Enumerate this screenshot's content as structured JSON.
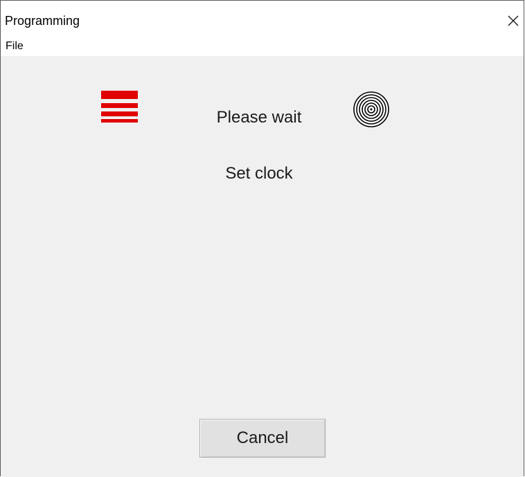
{
  "window": {
    "title": "Programming"
  },
  "menu": {
    "items": [
      {
        "label": "File"
      }
    ]
  },
  "icons": {
    "close": "close-icon",
    "progress": "red-stacked-bars-icon",
    "target": "concentric-circles-icon"
  },
  "status": {
    "main": "Please wait",
    "step": "Set clock"
  },
  "buttons": {
    "cancel_label": "Cancel"
  },
  "colors": {
    "progress_bars": "#e00000",
    "client_background": "#f0f0f0"
  }
}
